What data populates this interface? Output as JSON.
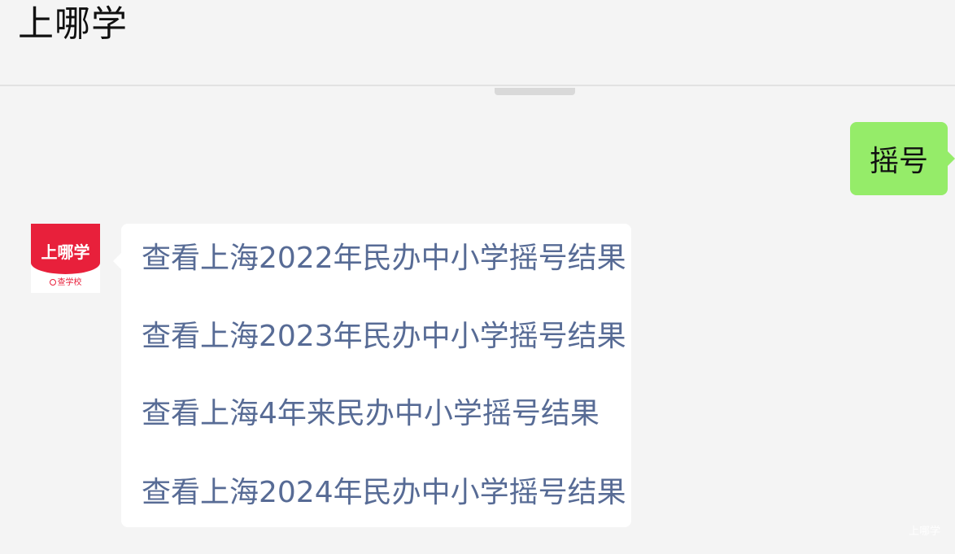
{
  "header": {
    "title": "上哪学"
  },
  "conversation": {
    "outgoing_message": "摇号",
    "bot_avatar": {
      "logo_text": "上哪学",
      "tagline": "查学校",
      "brand_color": "#e8203b"
    },
    "reply_links": [
      "查看上海2022年民办中小学摇号结果",
      "查看上海2023年民办中小学摇号结果",
      "查看上海4年来民办中小学摇号结果",
      "查看上海2024年民办中小学摇号结果"
    ]
  },
  "watermark": "上哪学",
  "colors": {
    "background": "#f4f4f4",
    "outgoing_bubble": "#95ec69",
    "incoming_bubble": "#ffffff",
    "link_text": "#576b95"
  }
}
